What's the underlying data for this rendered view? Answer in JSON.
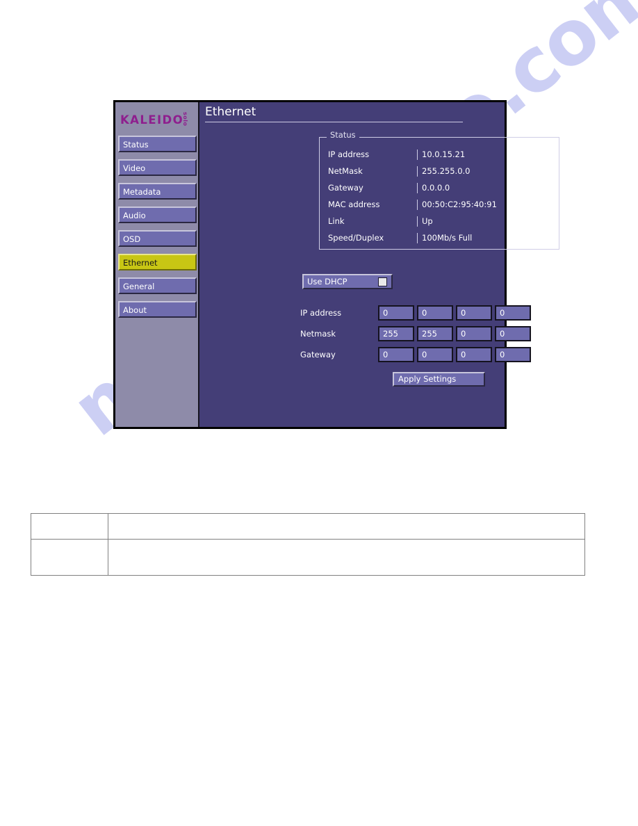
{
  "watermark": {
    "text": "manualshive.com"
  },
  "window": {
    "logo": {
      "main": "KALEIDO",
      "sub": "solo"
    },
    "sidebar": {
      "items": [
        {
          "label": "Status",
          "name": "sidebar-item-status",
          "active": false
        },
        {
          "label": "Video",
          "name": "sidebar-item-video",
          "active": false
        },
        {
          "label": "Metadata",
          "name": "sidebar-item-metadata",
          "active": false
        },
        {
          "label": "Audio",
          "name": "sidebar-item-audio",
          "active": false
        },
        {
          "label": "OSD",
          "name": "sidebar-item-osd",
          "active": false
        },
        {
          "label": "Ethernet",
          "name": "sidebar-item-ethernet",
          "active": true
        },
        {
          "label": "General",
          "name": "sidebar-item-general",
          "active": false
        },
        {
          "label": "About",
          "name": "sidebar-item-about",
          "active": false
        }
      ]
    },
    "page": {
      "title": "Ethernet",
      "status_group": {
        "legend": "Status",
        "rows": [
          {
            "label": "IP address",
            "value": "10.0.15.21"
          },
          {
            "label": "NetMask",
            "value": "255.255.0.0"
          },
          {
            "label": "Gateway",
            "value": "0.0.0.0"
          },
          {
            "label": "MAC address",
            "value": "00:50:C2:95:40:91"
          },
          {
            "label": "Link",
            "value": "Up"
          },
          {
            "label": "Speed/Duplex",
            "value": "100Mb/s  Full"
          }
        ]
      },
      "dhcp": {
        "label": "Use DHCP",
        "checked": false
      },
      "config": {
        "rows": [
          {
            "label": "IP address",
            "octets": [
              "0",
              "0",
              "0",
              "0"
            ]
          },
          {
            "label": "Netmask",
            "octets": [
              "255",
              "255",
              "0",
              "0"
            ]
          },
          {
            "label": "Gateway",
            "octets": [
              "0",
              "0",
              "0",
              "0"
            ]
          }
        ]
      },
      "apply_label": "Apply Settings"
    }
  },
  "bottom_table": {
    "rows": [
      {
        "cells": [
          "",
          ""
        ]
      },
      {
        "cells": [
          "",
          ""
        ]
      }
    ]
  },
  "colors": {
    "accent_highlight": "#c8c614",
    "logo": "#8e1f8e",
    "panel_bg": "#443e77",
    "sidebar_bg": "#8e8ba9",
    "button_bg": "#6f6cae",
    "watermark": "#b9bdf0"
  }
}
